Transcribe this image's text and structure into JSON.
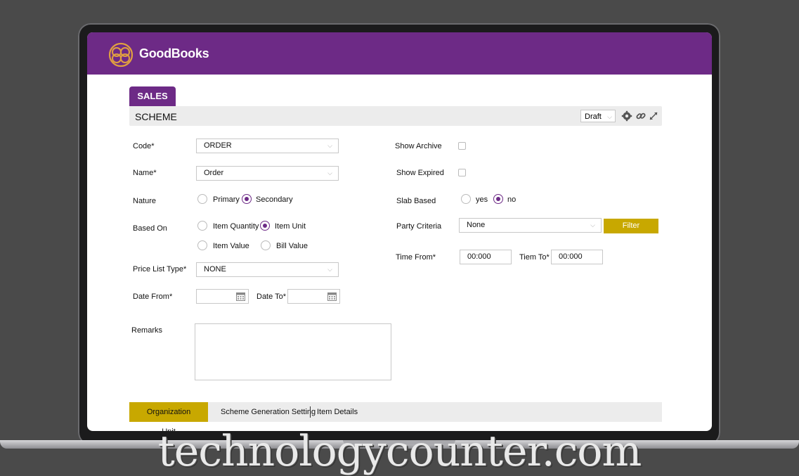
{
  "app": {
    "name": "GoodBooks"
  },
  "module_tab": "SALES",
  "form_title": "SCHEME",
  "status_select": "Draft",
  "fields": {
    "code": {
      "label": "Code*",
      "value": "ORDER"
    },
    "name": {
      "label": "Name*",
      "value": "Order"
    },
    "nature": {
      "label": "Nature",
      "options": [
        "Primary",
        "Secondary"
      ],
      "selected": "Secondary"
    },
    "based_on": {
      "label": "Based On",
      "options": [
        "Item Quantity",
        "Item Unit",
        "Item Value",
        "Bill Value"
      ],
      "selected": "Item Unit"
    },
    "price_list_type": {
      "label": "Price List Type*",
      "value": "NONE"
    },
    "date_from": {
      "label": "Date From*",
      "value": ""
    },
    "date_to": {
      "label": "Date To*",
      "value": ""
    },
    "remarks": {
      "label": "Remarks",
      "value": ""
    },
    "show_archive": {
      "label": "Show Archive",
      "checked": false
    },
    "show_expired": {
      "label": "Show Expired",
      "checked": false
    },
    "slab_based": {
      "label": "Slab Based",
      "options": [
        "yes",
        "no"
      ],
      "selected": "no"
    },
    "party_criteria": {
      "label": "Party Criteria",
      "value": "None"
    },
    "time_from": {
      "label": "Time From*",
      "value": "00:000"
    },
    "time_to": {
      "label": "Tiem To*",
      "value": "00:000"
    }
  },
  "filter_button": "Filter",
  "bottom_tabs": [
    "Organization Unit",
    "Scheme Generation Setting",
    "Item Details"
  ],
  "active_bottom_tab": "Organization Unit",
  "colors": {
    "brand_purple": "#6d2a86",
    "accent_gold": "#c8a800"
  },
  "watermark": "technologycounter.com"
}
